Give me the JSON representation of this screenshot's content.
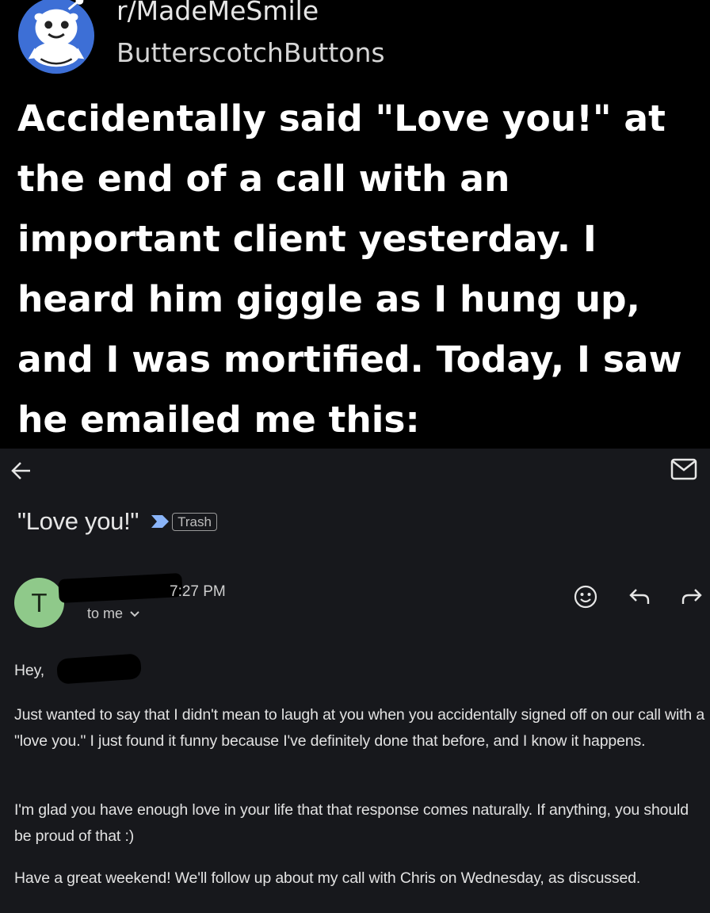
{
  "post": {
    "subreddit": "r/MadeMeSmile",
    "username": "ButterscotchButtons",
    "title": "Accidentally said \"Love you!\" at the end of a call with an important client yesterday. I heard him giggle as I hung up, and I was mortified. Today, I saw he emailed me this:"
  },
  "email": {
    "subject": "\"Love you!\"",
    "label": "Trash",
    "sender_initial": "T",
    "time": "7:27 PM",
    "recipient": "to me",
    "greeting": "Hey,",
    "paragraphs": [
      "Just wanted to say that I didn't mean to laugh at you when you accidentally signed off on our call with a \"love you.\" I just found it funny because I've definitely done that before, and I know it happens.",
      "I'm glad you have enough love in your life that that response comes naturally. If anything, you should be proud of that :)",
      "Have a great weekend! We'll follow up about my call with Chris on Wednesday, as discussed."
    ],
    "icons": {
      "back": "back-arrow-icon",
      "mail": "mail-icon",
      "importance": "importance-marker-icon",
      "emoji": "emoji-reaction-icon",
      "reply": "reply-icon",
      "forward": "forward-icon"
    }
  },
  "colors": {
    "post_background": "#000000",
    "email_background": "#17181c",
    "avatar_green": "#8fc98a",
    "importance_blue": "#8ab4f8"
  }
}
